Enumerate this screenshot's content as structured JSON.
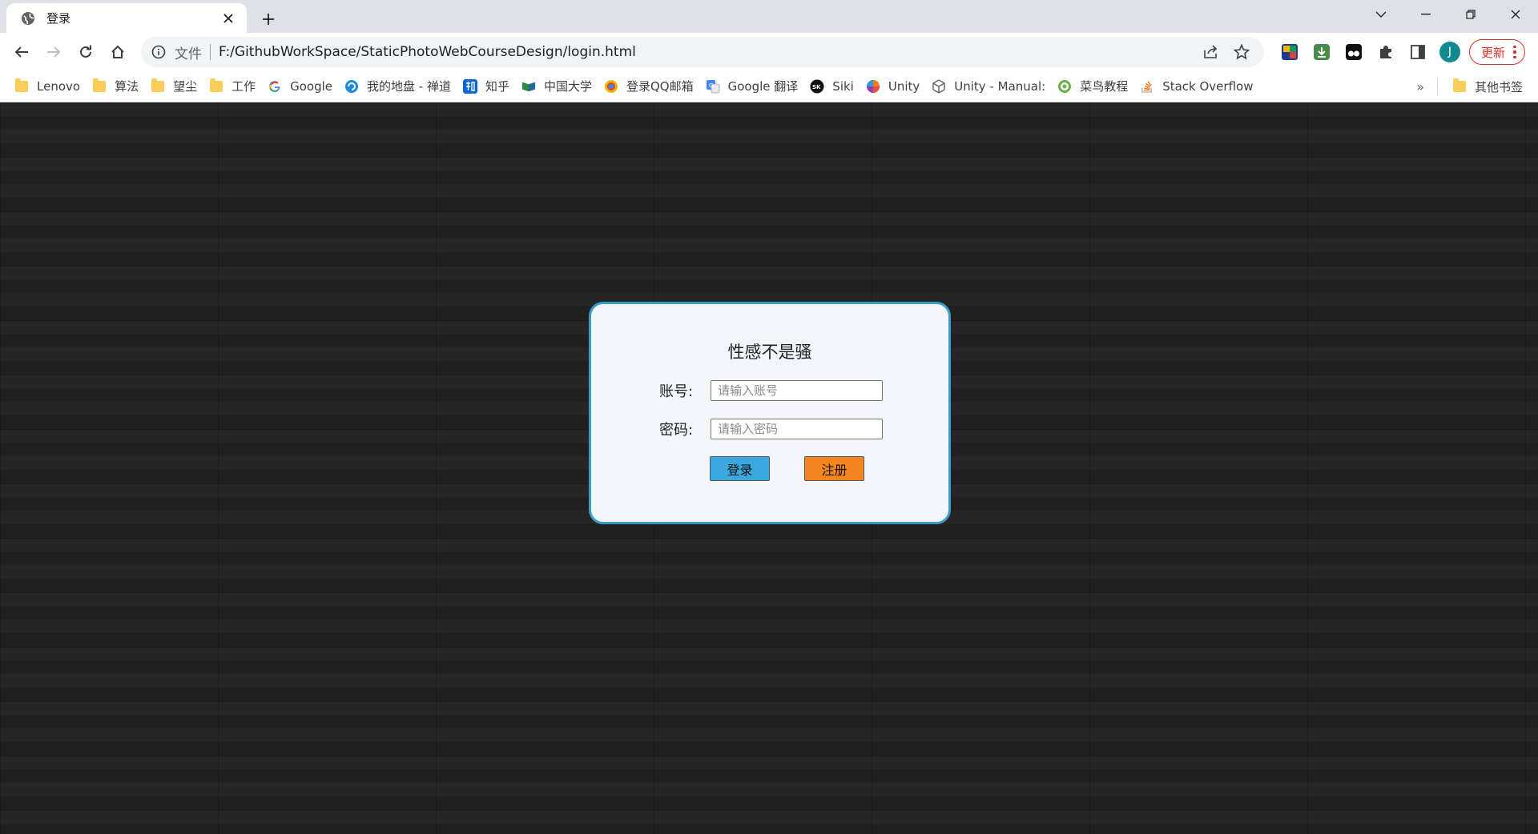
{
  "browser": {
    "tab": {
      "title": "登录"
    },
    "omnibox": {
      "scheme_label": "文件",
      "url": "F:/GithubWorkSpace/StaticPhotoWebCourseDesign/login.html"
    },
    "profile_initial": "J",
    "update_label": "更新",
    "bookmarks": [
      {
        "label": "Lenovo",
        "icon": "folder-icon"
      },
      {
        "label": "算法",
        "icon": "folder-icon"
      },
      {
        "label": "望尘",
        "icon": "folder-icon"
      },
      {
        "label": "工作",
        "icon": "folder-icon"
      },
      {
        "label": "Google",
        "icon": "google-icon"
      },
      {
        "label": "我的地盘 - 禅道",
        "icon": "zentao-icon"
      },
      {
        "label": "知乎",
        "icon": "zhihu-icon"
      },
      {
        "label": "中国大学",
        "icon": "mooc-icon"
      },
      {
        "label": "登录QQ邮箱",
        "icon": "qqmail-icon"
      },
      {
        "label": "Google 翻译",
        "icon": "translate-icon"
      },
      {
        "label": "Siki",
        "icon": "siki-icon"
      },
      {
        "label": "Unity",
        "icon": "unity-icon"
      },
      {
        "label": "Unity - Manual:",
        "icon": "unity-manual-icon"
      },
      {
        "label": "菜鸟教程",
        "icon": "runoob-icon"
      },
      {
        "label": "Stack Overflow",
        "icon": "stackoverflow-icon"
      }
    ],
    "overflow_label": "»",
    "other_bookmarks": "其他书签"
  },
  "login": {
    "title": "性感不是骚",
    "account_label": "账号:",
    "account_placeholder": "请输入账号",
    "password_label": "密码:",
    "password_placeholder": "请输入密码",
    "login_button": "登录",
    "register_button": "注册"
  },
  "colors": {
    "card_border": "#3b9cc7",
    "card_bg": "#f2f6fa",
    "login_button": "#3aa9e0",
    "register_button": "#f5861f",
    "update_accent": "#d93025"
  }
}
